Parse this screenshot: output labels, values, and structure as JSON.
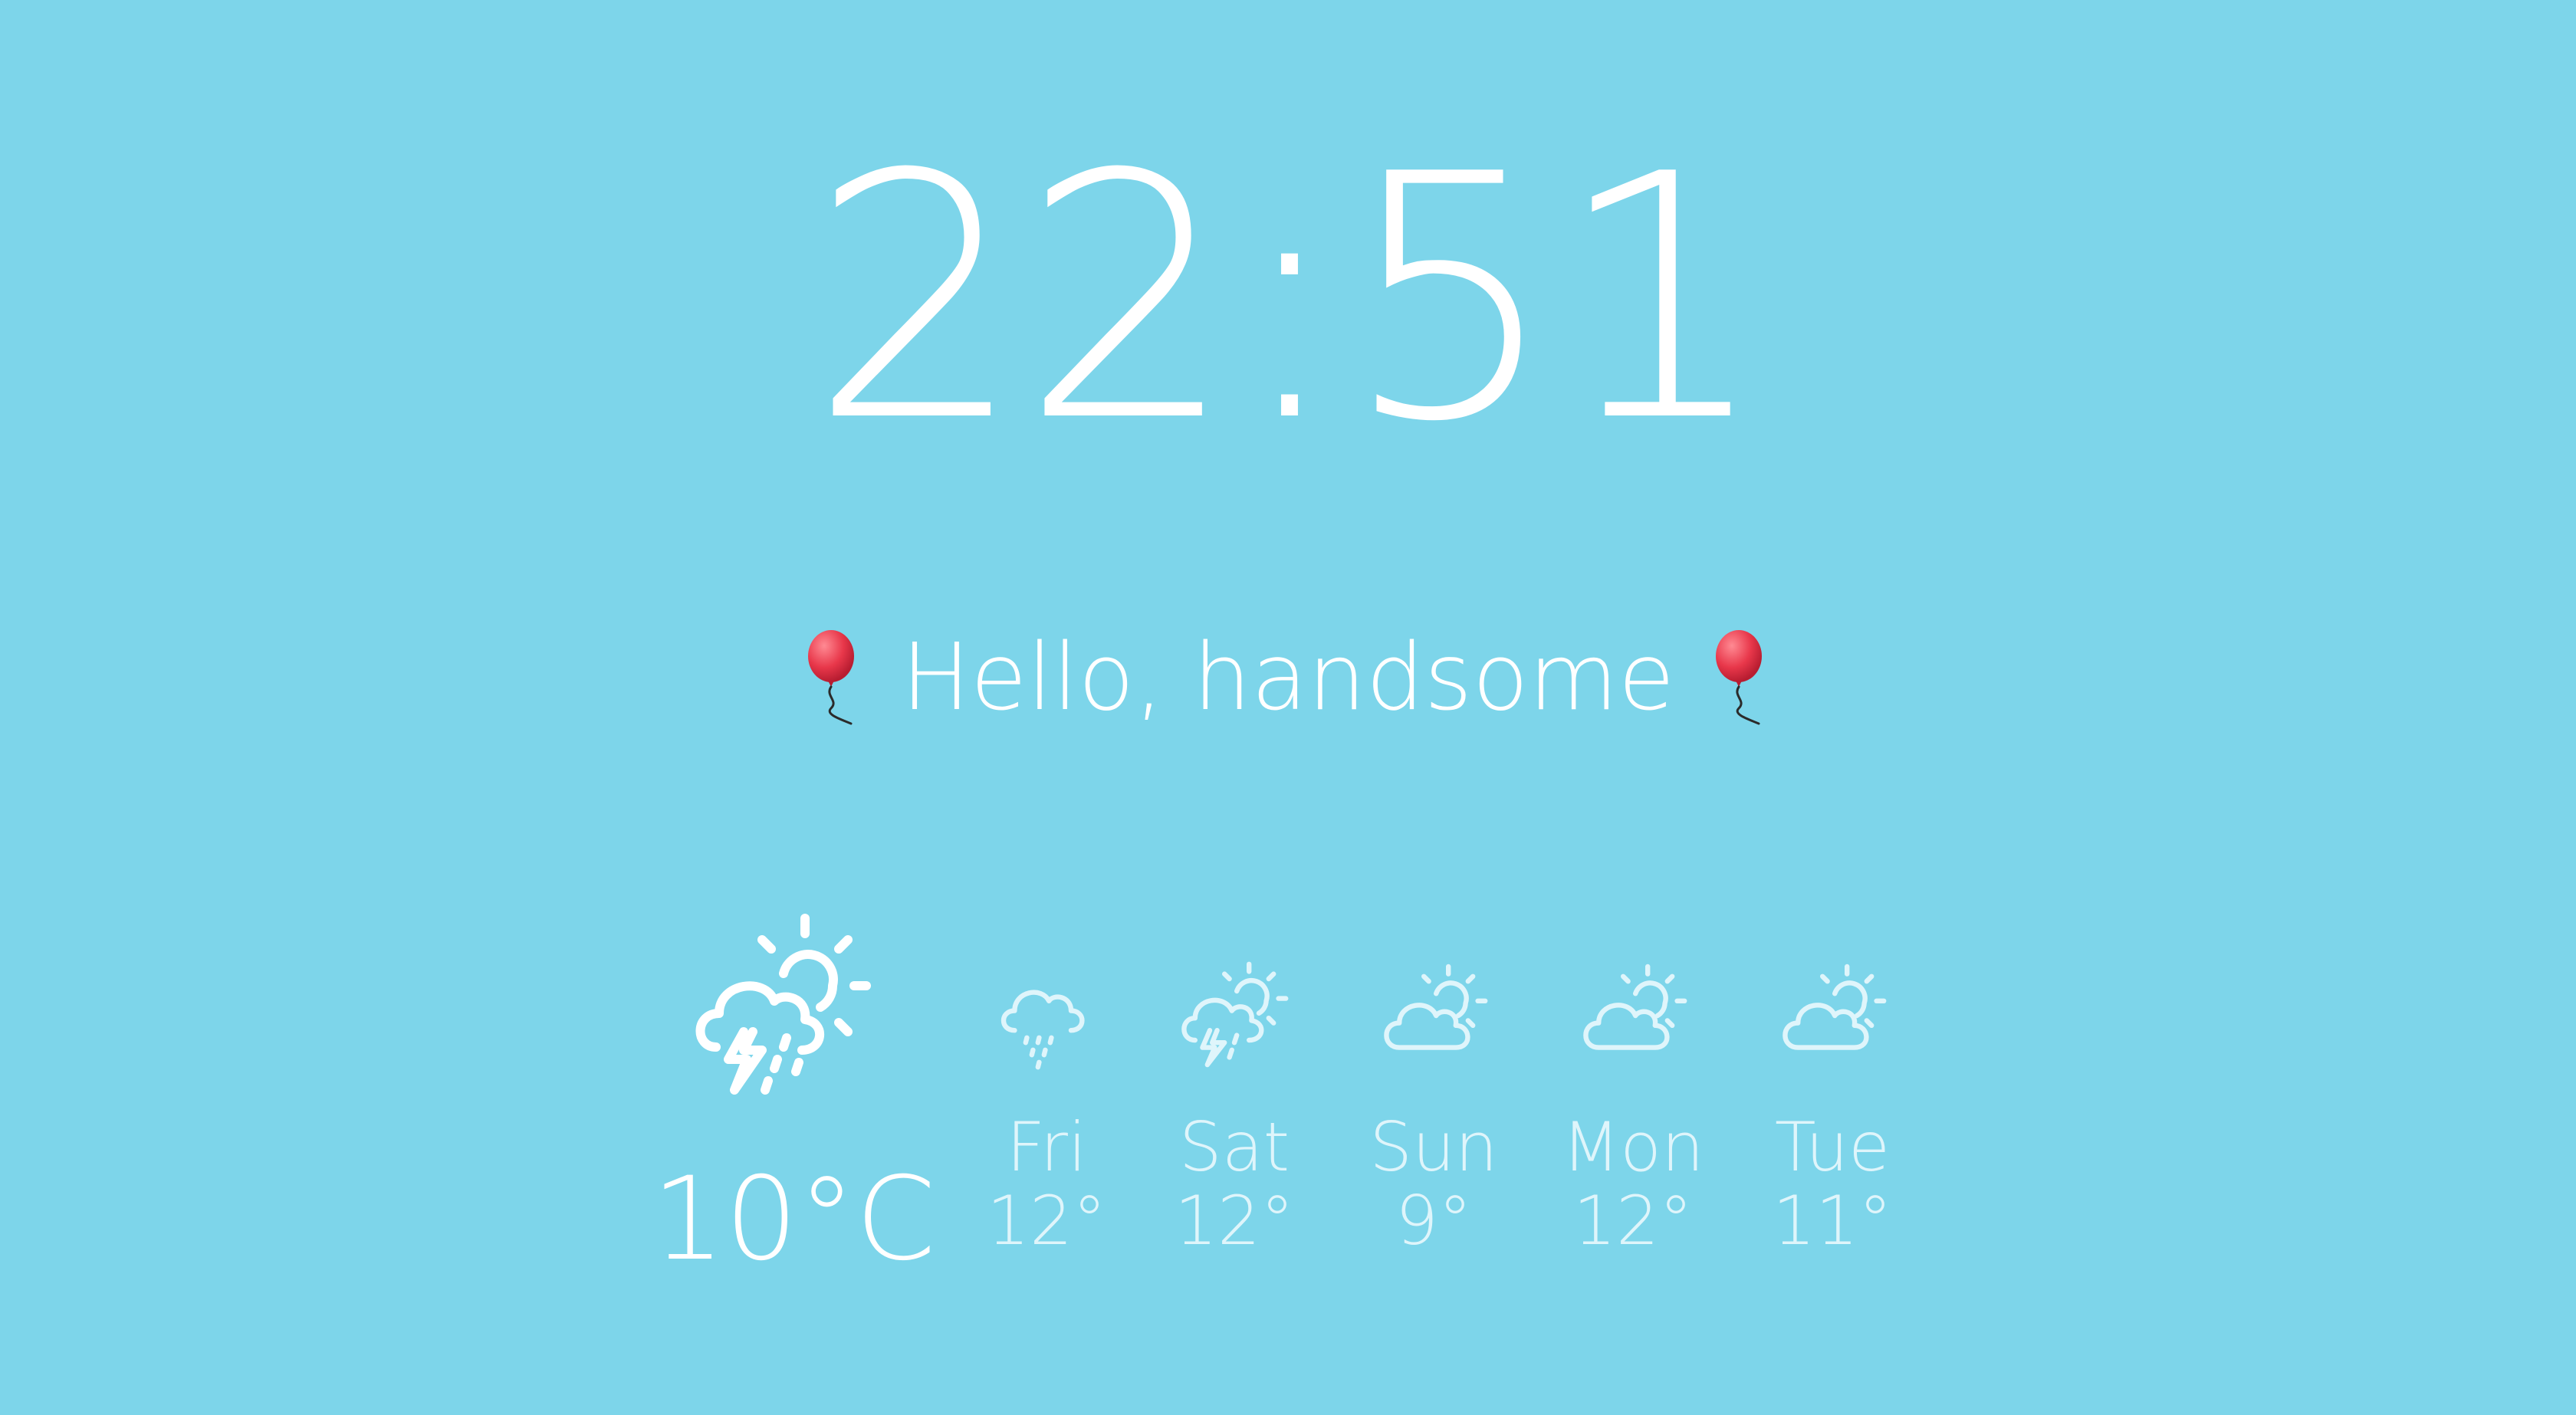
{
  "clock": {
    "time": "22:51"
  },
  "greeting": {
    "text": "Hello, handsome",
    "icon": "balloon-icon"
  },
  "colors": {
    "background": "#7dd5ea",
    "text": "#ffffff",
    "forecast_text": "#dff5fb",
    "balloon": "#e8374a"
  },
  "weather": {
    "current": {
      "temp": "10°C",
      "icon": "thunderstorm-partly-sunny-icon"
    },
    "forecast": [
      {
        "day": "Fri",
        "temp": "12°",
        "icon": "drizzle-icon"
      },
      {
        "day": "Sat",
        "temp": "12°",
        "icon": "thunderstorm-partly-sunny-icon"
      },
      {
        "day": "Sun",
        "temp": "9°",
        "icon": "partly-cloudy-icon"
      },
      {
        "day": "Mon",
        "temp": "12°",
        "icon": "partly-cloudy-icon"
      },
      {
        "day": "Tue",
        "temp": "11°",
        "icon": "partly-cloudy-icon"
      }
    ]
  }
}
